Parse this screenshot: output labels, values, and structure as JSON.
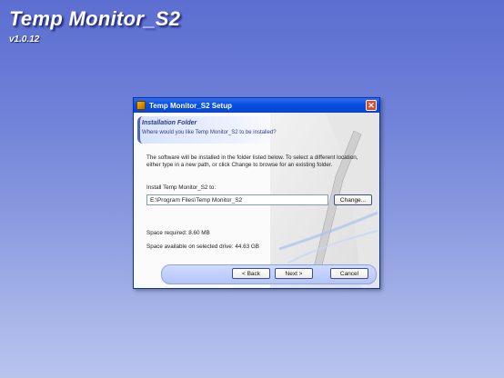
{
  "app": {
    "title": "Temp Monitor_S2",
    "version": "v1.0.12"
  },
  "dialog": {
    "title": "Temp Monitor_S2 Setup",
    "close_label": "✕",
    "header_title": "Installation Folder",
    "header_sub": "Where would you like Temp Monitor_S2 to be installed?",
    "description": "The software will be installed in the folder listed below. To select a different location, either type in a new path, or click Change to browse for an existing folder.",
    "install_label": "Install Temp Monitor_S2 to:",
    "install_path": "E:\\Program Files\\Temp Monitor_S2",
    "change_button": "Change...",
    "space_required": "Space required: 8.60 MB",
    "space_available": "Space available on selected drive: 44.63 GB",
    "back_button": "< Back",
    "next_button": "Next >",
    "cancel_button": "Cancel"
  },
  "colors": {
    "background": "#6f81d8",
    "titlebar": "#0a4ee0",
    "accent": "#4a67c7"
  }
}
